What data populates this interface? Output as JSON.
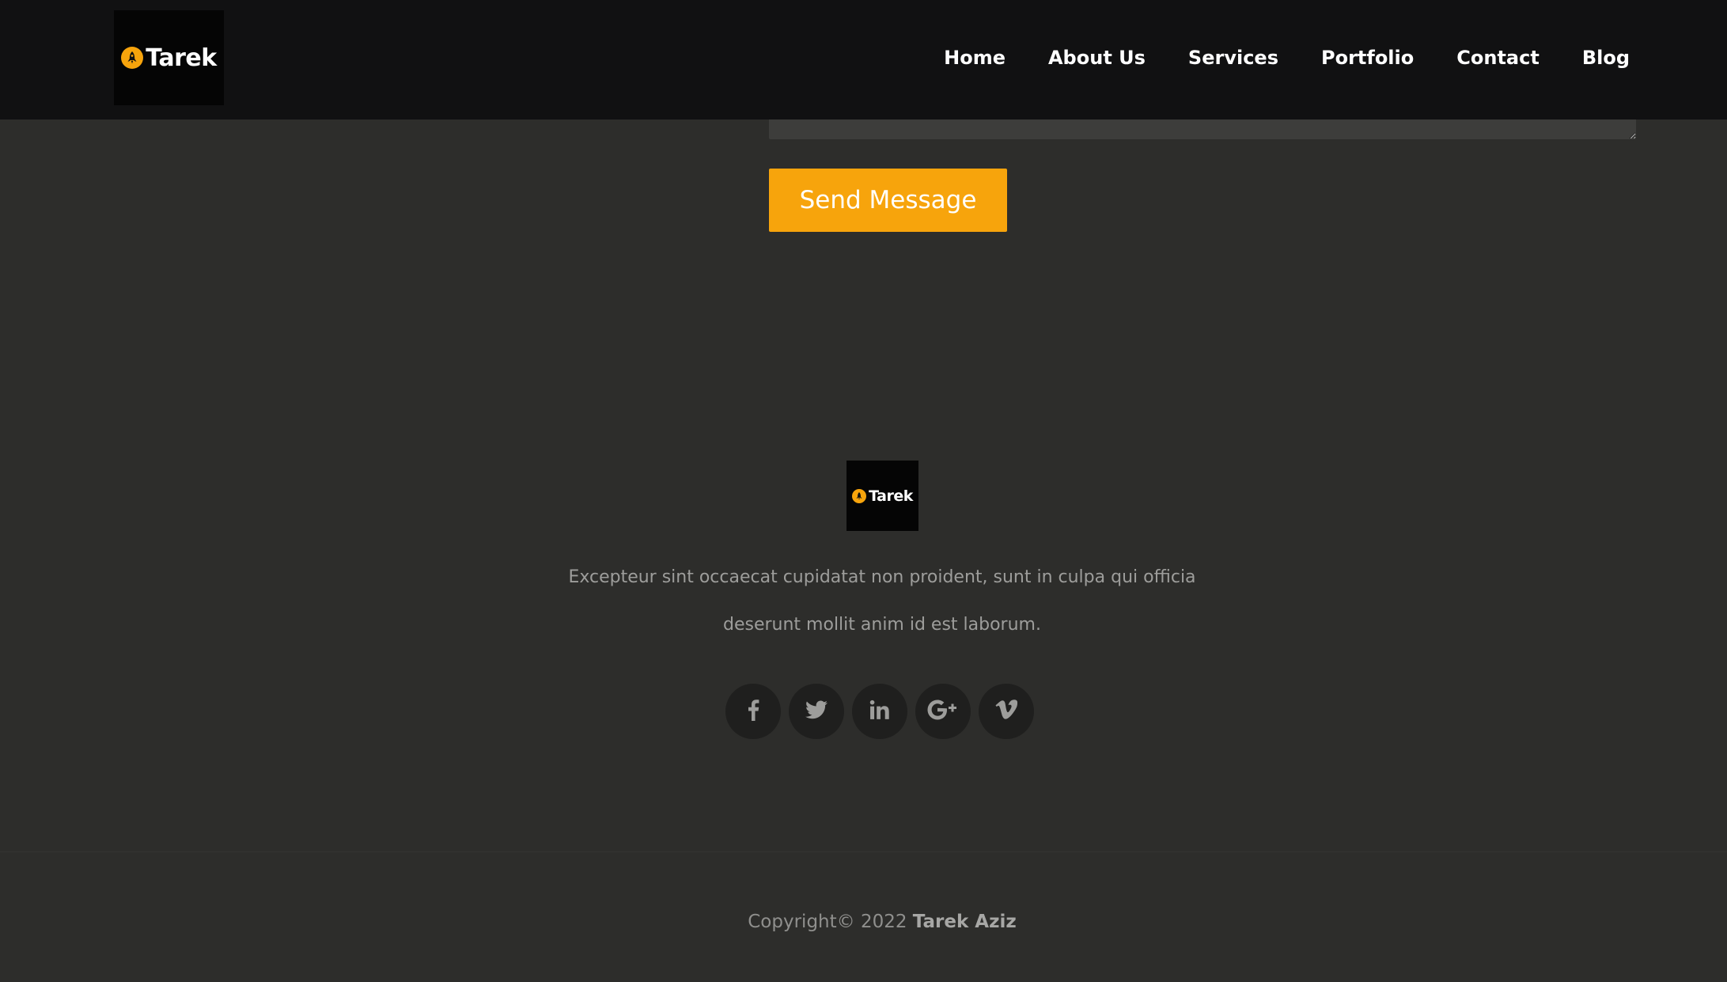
{
  "brand": {
    "name": "Tarek",
    "accent_color": "#f7a40c"
  },
  "nav": {
    "items": [
      {
        "label": "Home"
      },
      {
        "label": "About Us"
      },
      {
        "label": "Services"
      },
      {
        "label": "Portfolio"
      },
      {
        "label": "Contact"
      },
      {
        "label": "Blog"
      }
    ]
  },
  "contact_form": {
    "message_value": "",
    "send_label": "Send Message"
  },
  "footer": {
    "logo_text": "Tarek",
    "description_line1": "Excepteur sint occaecat cupidatat non proident, sunt in culpa qui officia",
    "description_line2": "deserunt mollit anim id est laborum.",
    "social": [
      {
        "icon": "facebook-icon"
      },
      {
        "icon": "twitter-icon"
      },
      {
        "icon": "linkedin-icon"
      },
      {
        "icon": "google-plus-icon"
      },
      {
        "icon": "vimeo-icon"
      }
    ],
    "copyright_prefix": "Copyright© 2022 ",
    "copyright_name": "Tarek Aziz"
  },
  "colors": {
    "background": "#2d2d2b",
    "header_background": "#111112",
    "social_circle": "#1f1f1e",
    "muted_text": "#9d9d9b"
  }
}
